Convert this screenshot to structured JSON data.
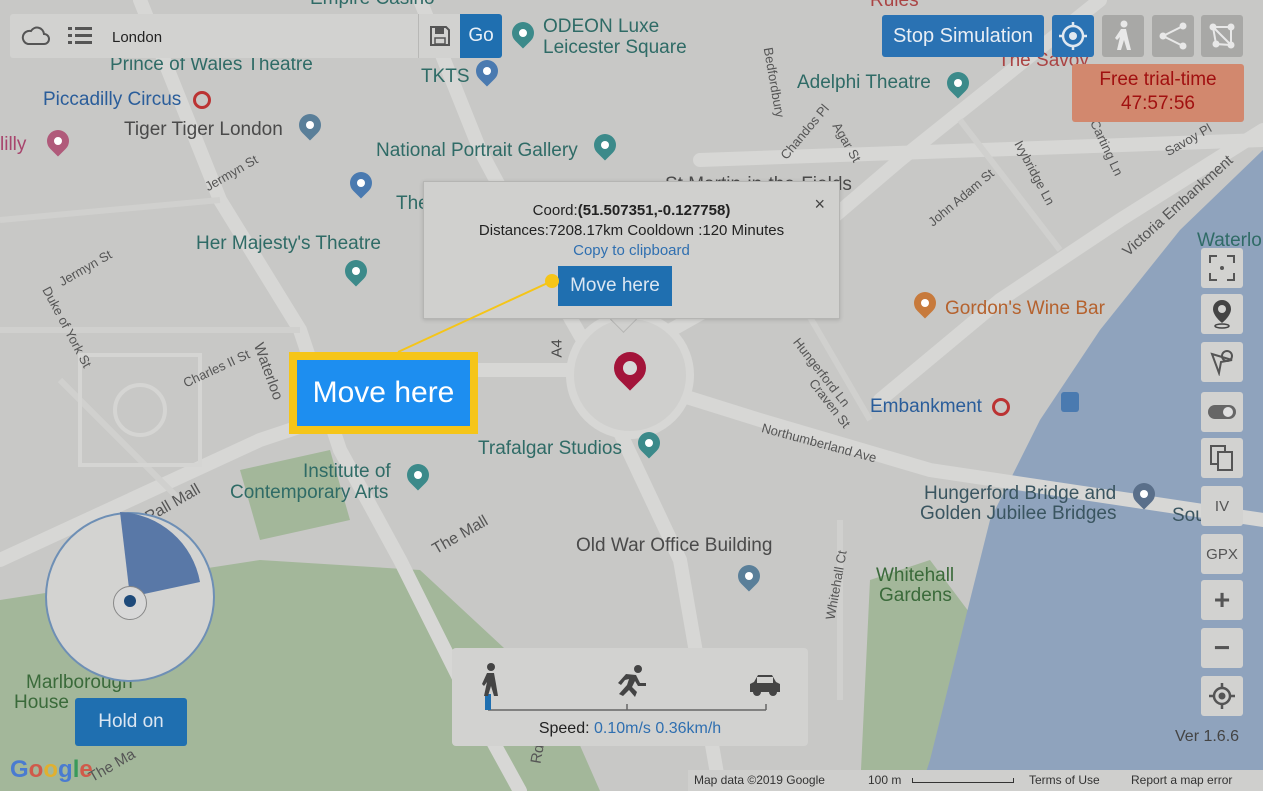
{
  "search": {
    "value": "London",
    "go_label": "Go"
  },
  "header": {
    "stop_simulation_label": "Stop Simulation"
  },
  "trial": {
    "label": "Free trial-time",
    "time": "47:57:56"
  },
  "popup": {
    "coord_label": "Coord:",
    "coord_value": "(51.507351,-0.127758)",
    "distances": "Distances:7208.17km Cooldown :120 Minutes",
    "copy_label": "Copy to clipboard",
    "move_label": "Move here",
    "close_glyph": "×"
  },
  "callout": {
    "label": "Move here"
  },
  "right_toolbar": {
    "iv_label": "IV",
    "gpx_label": "GPX",
    "zoom_in": "+",
    "zoom_out": "−"
  },
  "speed": {
    "label": "Speed:",
    "value": "0.10m/s 0.36km/h"
  },
  "hold_on": {
    "label": "Hold on"
  },
  "version": "Ver 1.6.6",
  "footer": {
    "map_data": "Map data ©2019 Google",
    "scale": "100 m",
    "terms": "Terms of Use",
    "report": "Report a map error"
  },
  "google_logo": "Google",
  "map": {
    "places": {
      "empire_casino": "Empire Casino",
      "prince_of_wales": "Prince of Wales Theatre",
      "piccadilly_circus": "Piccadilly Circus",
      "tiger_tiger": "Tiger Tiger London",
      "lilly": "lilly",
      "odeon": "ODEON Luxe",
      "odeon2": "Leicester Square",
      "tkts": "TKTS",
      "national_portrait": "National Portrait Gallery",
      "st_martin": "St Martin-in-the-Fields",
      "the": "The",
      "her_majestys": "Her Majesty's Theatre",
      "rules": "Rules",
      "the_savoy": "The Savoy",
      "adelphi": "Adelphi Theatre",
      "waterloo": "Waterlo",
      "gordons": "Gordon's Wine Bar",
      "embankment": "Embankment",
      "trafalgar_studios": "Trafalgar Studios",
      "institute1": "Institute of",
      "institute2": "Contemporary Arts",
      "hungerford1": "Hungerford Bridge and",
      "hungerford2": "Golden Jubilee Bridges",
      "sou": "Sou",
      "old_war": "Old War Office Building",
      "whitehall1": "Whitehall",
      "whitehall2": "Gardens",
      "marlborough1": "Marlborough",
      "marlborough2": "House",
      "a4": "A4"
    },
    "streets": {
      "jermyn1": "Jermyn St",
      "jermyn2": "Jermyn St",
      "duke_of_york": "Duke of York St",
      "charles_ii": "Charles II St",
      "waterloo_pl": "Waterloo",
      "pall_mall": "Pall Mall",
      "the_mall": "The Mall",
      "bedfordbury": "Bedfordbury",
      "chandos": "Chandos Pl",
      "agar": "Agar St",
      "john_adam": "John Adam St",
      "ivybridge": "Ivybridge Ln",
      "carting": "Carting Ln",
      "savoy_pl": "Savoy Pl",
      "victoria_emb": "Victoria Embankment",
      "hungerford_ln": "Hungerford Ln",
      "craven": "Craven St",
      "northumberland": "Northumberland Ave",
      "whitehall_ct": "Whitehall Ct",
      "rd": "Rd",
      "the_ma": "The Ma"
    }
  }
}
